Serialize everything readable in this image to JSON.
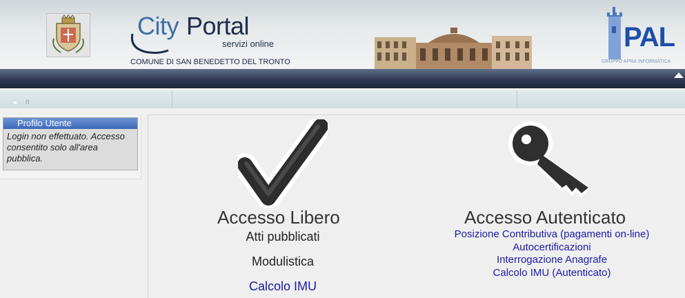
{
  "header": {
    "logo": {
      "city": "City",
      "portal": "Portal",
      "tagline": "servizi online"
    },
    "municipality": "COMUNE DI SAN BENEDETTO DEL TRONTO",
    "partner": {
      "name": "PAL",
      "caption": "GRUPPO APRA INFORMATICA"
    }
  },
  "sidebar": {
    "profile": {
      "title": "Profilo Utente",
      "status": "Login non effettuato. Accesso consentito solo all'area pubblica."
    }
  },
  "main": {
    "free": {
      "title": "Accesso Libero",
      "items": [
        "Atti pubblicati",
        "Modulistica"
      ],
      "link": "Calcolo IMU"
    },
    "auth": {
      "title": "Accesso Autenticato",
      "links": [
        "Posizione Contributiva (pagamenti on-line)",
        "Autocertificazioni",
        "Interrogazione Anagrafe",
        "Calcolo IMU (Autenticato)"
      ]
    }
  },
  "icons": [
    "home-icon",
    "checkmark-icon",
    "key-icon",
    "collapse-arrow-icon"
  ],
  "colors": {
    "nav_bar": "#2f3a52",
    "profile_header": "#4a75c4",
    "link": "#1a1aa6"
  }
}
